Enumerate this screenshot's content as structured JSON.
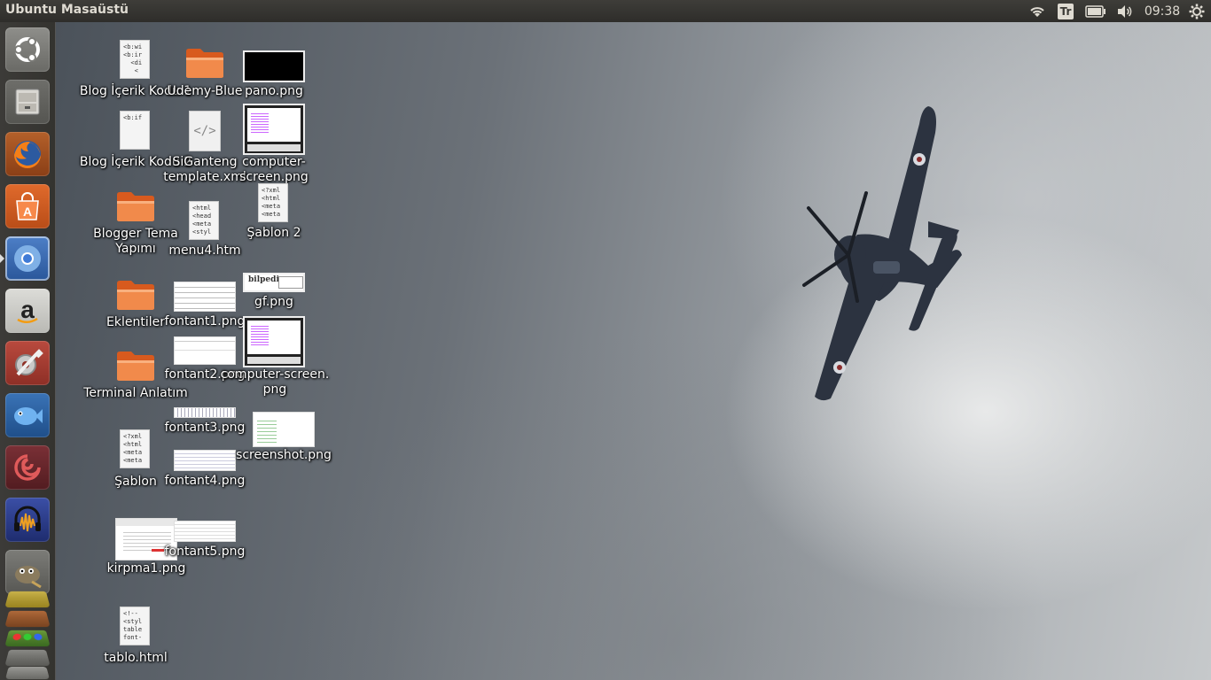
{
  "panel": {
    "title": "Ubuntu Masaüstü",
    "lang": "Tr",
    "clock": "09:38"
  },
  "launcher": {
    "items": [
      {
        "name": "dash-home",
        "icon": "ubuntu-logo-icon"
      },
      {
        "name": "files",
        "icon": "file-cabinet-icon"
      },
      {
        "name": "firefox",
        "icon": "firefox-icon"
      },
      {
        "name": "software-center",
        "icon": "shopping-bag-icon"
      },
      {
        "name": "chromium",
        "icon": "chromium-icon"
      },
      {
        "name": "amazon",
        "icon": "amazon-icon"
      },
      {
        "name": "system-settings",
        "icon": "wrench-gear-icon"
      },
      {
        "name": "bluefish",
        "icon": "fish-icon"
      },
      {
        "name": "mypaint",
        "icon": "swirl-icon"
      },
      {
        "name": "audacity",
        "icon": "headphones-icon"
      },
      {
        "name": "gimp",
        "icon": "gimp-icon"
      }
    ]
  },
  "desktop": {
    "icons": {
      "blog1": "Blog İçerik Kodu 1",
      "udemy": "Udemy-Blue",
      "pano": "pano.png",
      "blog2": "Blog İçerik Kodu 2",
      "siganteng1": "SiGanteng",
      "siganteng2": "template.xml",
      "computer1": "computer-",
      "computer2": "screen.png",
      "blogger1": "Blogger Tema",
      "blogger2": "Yapımı",
      "menu4": "menu4.htm",
      "sablon2": "Şablon 2",
      "eklentiler": "Eklentiler",
      "fontant1": "fontant1.png",
      "gf": "gf.png",
      "terminal": "Terminal Anlatım",
      "fontant2": "fontant2.png",
      "cscreen1": "computer-screen.",
      "cscreen2": "png",
      "fontant3": "fontant3.png",
      "screenshot": "screenshot.png",
      "sablon": "Şablon",
      "fontant4": "fontant4.png",
      "kirpma1": "kirpma1.png",
      "fontant5": "fontant5.png",
      "tablo": "tablo.html"
    },
    "snippets": {
      "blog1": "<b:wi\n<b:ir\n  <di\n   <",
      "blog2": "<b:if",
      "menu4": "<html\n<head\n<meta\n<styl",
      "sablon2": "<?xml\n<html\n<meta\n<meta",
      "sablon": "<?xml\n<html\n<meta\n<meta",
      "tablo": "<!--\n<styl\ntable\nfont-",
      "gf": "bilpedi"
    }
  }
}
